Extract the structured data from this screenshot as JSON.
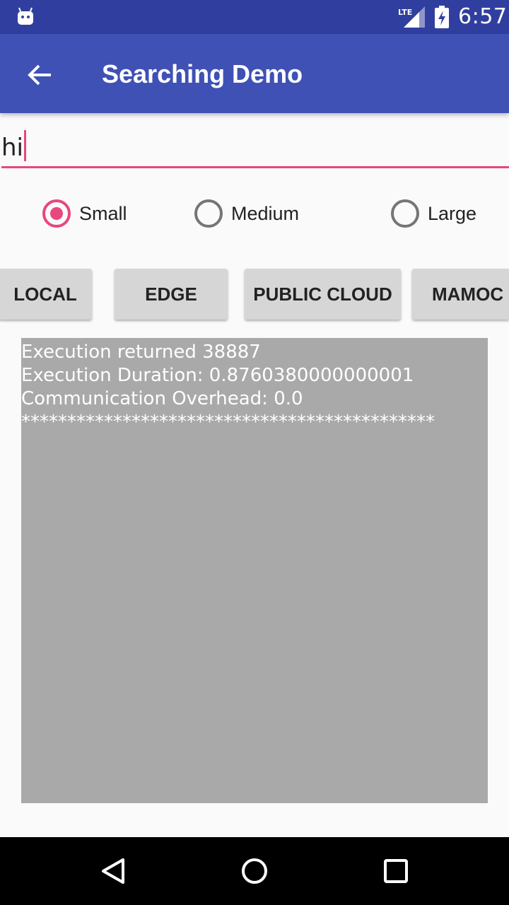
{
  "status_bar": {
    "time": "6:57",
    "network": "LTE",
    "icons": [
      "android-debug-icon",
      "lte-signal-icon",
      "battery-charging-icon"
    ]
  },
  "app_bar": {
    "title": "Searching Demo",
    "back_icon": "arrow-back-icon"
  },
  "search": {
    "value": "hi"
  },
  "size_options": [
    {
      "label": "Small",
      "checked": true
    },
    {
      "label": "Medium",
      "checked": false
    },
    {
      "label": "Large",
      "checked": false
    }
  ],
  "buttons": {
    "local": "LOCAL",
    "edge": "EDGE",
    "public_cloud": "PUBLIC CLOUD",
    "mamoc": "MAMOC"
  },
  "output": {
    "lines": [
      "Execution returned 38887",
      "Execution Duration: 0.8760380000000001",
      "Communication Overhead: 0.0",
      "*********************************************"
    ]
  },
  "nav_bar": {
    "icons": [
      "back-triangle-icon",
      "home-circle-icon",
      "recents-square-icon"
    ]
  },
  "colors": {
    "primary": "#3f51b5",
    "primary_dark": "#303f9f",
    "accent": "#e8477f",
    "output_bg": "#a9a9a9"
  }
}
